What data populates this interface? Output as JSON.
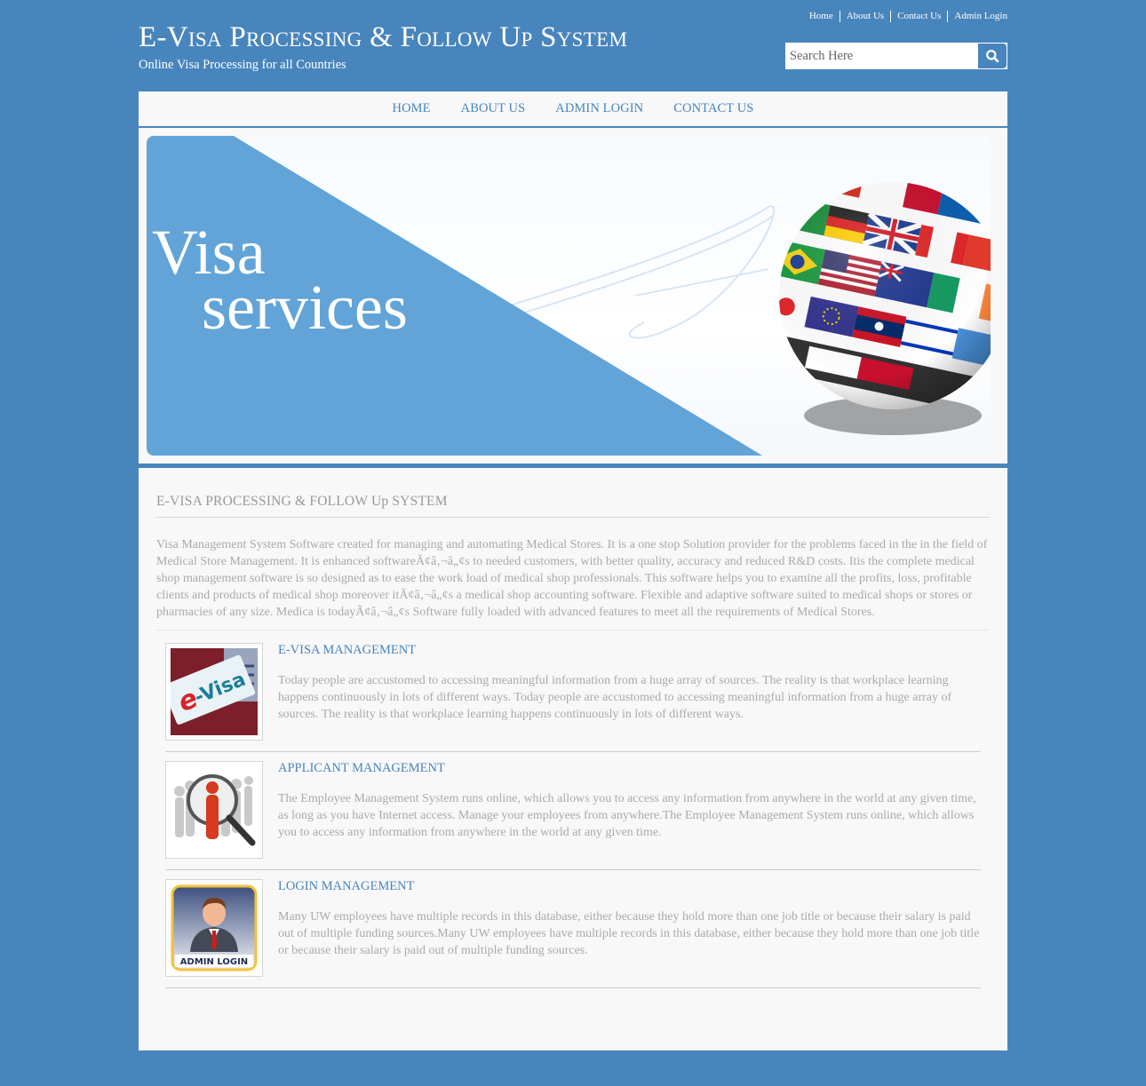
{
  "header": {
    "title": "E-Visa Processing & Follow Up System",
    "tagline": "Online Visa Processing for all Countries",
    "top_links": [
      "Home",
      "About Us",
      "Contact Us",
      "Admin Login"
    ],
    "search": {
      "placeholder": "Search Here",
      "value": "",
      "icon": "search-icon"
    }
  },
  "nav": {
    "items": [
      "HOME",
      "ABOUT US",
      "ADMIN LOGIN",
      "CONTACT US"
    ]
  },
  "banner": {
    "line1": "Visa",
    "line2": "services",
    "image": "flags-globe"
  },
  "content": {
    "heading": "E-VISA PROCESSING & FOLLOW Up SYSTEM",
    "intro": "Visa Management System Software created for managing and automating Medical Stores. It is a one stop Solution provider for the problems faced in the in the field of Medical Store Management. It is enhanced softwareÃ¢â‚¬â„¢s to needed customers, with better quality, accuracy and reduced R&D costs. Itis the complete medical shop management software is so designed as to ease the work load of medical shop professionals. This software helps you to examine all the profits, loss, profitable clients and products of medical shop moreover itÃ¢â‚¬â„¢s a medical shop accounting software. Flexible and adaptive software suited to medical shops or stores or pharmacies of any size. Medica is todayÃ¢â‚¬â„¢s Software fully loaded with advanced features to meet all the requirements of Medical Stores.",
    "features": [
      {
        "title": "E-VISA MANAGEMENT",
        "image": "e-visa-image",
        "image_text": "e-Visa",
        "text": "Today people are accustomed to accessing meaningful information from a huge array of sources. The reality is that workplace learning happens continuously in lots of different ways. Today people are accustomed to accessing meaningful information from a huge array of sources. The reality is that workplace learning happens continuously in lots of different ways."
      },
      {
        "title": "APPLICANT MANAGEMENT",
        "image": "applicant-search-image",
        "text": "The Employee Management System runs online, which allows you to access any information from anywhere in the world at any given time, as long as you have Internet access. Manage your employees from anywhere.The Employee Management System runs online, which allows you to access any information from anywhere in the world at any given time."
      },
      {
        "title": "LOGIN MANAGEMENT",
        "image": "admin-login-image",
        "image_text": "ADMIN LOGIN",
        "text": "Many UW employees have multiple records in this database, either because they hold more than one job title or because their salary is paid out of multiple funding sources.Many UW employees have multiple records in this database, either because they hold more than one job title or because their salary is paid out of multiple funding sources."
      }
    ]
  },
  "colors": {
    "brand_blue": "#4885bd",
    "banner_blue": "#62a4d7",
    "panel_bg": "#f8f8f8",
    "body_text": "#aaaaaa"
  }
}
